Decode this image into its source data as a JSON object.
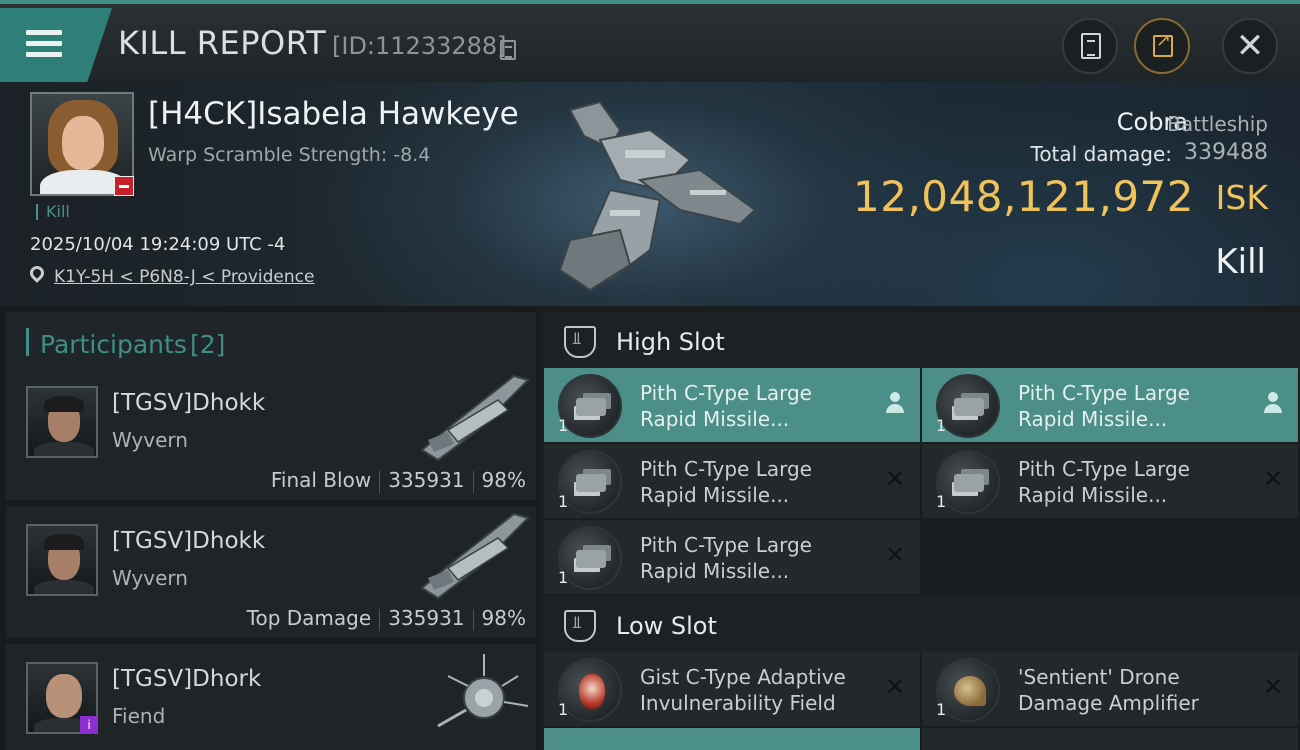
{
  "header": {
    "title": "KILL REPORT",
    "report_id": "[ID:11233288]"
  },
  "victim": {
    "name": "[H4CK]Isabela Hawkeye",
    "warp_scramble": "Warp Scramble Strength: -8.4",
    "tag": "Kill",
    "timestamp": "2025/10/04 19:24:09 UTC -4",
    "location": "K1Y-5H < P6N8-J < Providence",
    "ship_name": "Cobra",
    "ship_class": "Battleship",
    "total_damage_label": "Total damage:",
    "total_damage": "339488",
    "isk_value": "12,048,121,972",
    "isk_unit": "ISK",
    "result": "Kill"
  },
  "participants": {
    "title": "Participants",
    "count": "[2]",
    "rows": [
      {
        "name": "[TGSV]Dhokk",
        "ship": "Wyvern",
        "role": "Final Blow",
        "damage": "335931",
        "percent": "98%"
      },
      {
        "name": "[TGSV]Dhokk",
        "ship": "Wyvern",
        "role": "Top Damage",
        "damage": "335931",
        "percent": "98%"
      },
      {
        "name": "[TGSV]Dhork",
        "ship": "Fiend"
      }
    ]
  },
  "high_slot": {
    "title": "High Slot",
    "modules": [
      {
        "qty": "1",
        "line1": "Pith C-Type Large",
        "line2": "Rapid Missile..."
      },
      {
        "qty": "1",
        "line1": "Pith C-Type Large",
        "line2": "Rapid Missile..."
      },
      {
        "qty": "1",
        "line1": "Pith C-Type Large",
        "line2": "Rapid Missile..."
      },
      {
        "qty": "1",
        "line1": "Pith C-Type Large",
        "line2": "Rapid Missile..."
      },
      {
        "qty": "1",
        "line1": "Pith C-Type Large",
        "line2": "Rapid Missile..."
      }
    ]
  },
  "low_slot": {
    "title": "Low Slot",
    "modules": [
      {
        "qty": "1",
        "line1": "Gist C-Type Adaptive",
        "line2": "Invulnerability Field"
      },
      {
        "qty": "1",
        "line1": "'Sentient' Drone",
        "line2": "Damage Amplifier"
      }
    ]
  },
  "colors": {
    "accent_teal": "#3f8f86",
    "isk_gold": "#f0c25a",
    "active_module": "#4b8f88"
  },
  "icons": {
    "menu": "hamburger-icon",
    "copy": "copy-icon",
    "clipboard": "clipboard-icon",
    "share": "share-icon",
    "close": "close-icon",
    "location": "location-pin-icon",
    "dropped": "pilot-icon",
    "destroyed": "x-icon"
  }
}
